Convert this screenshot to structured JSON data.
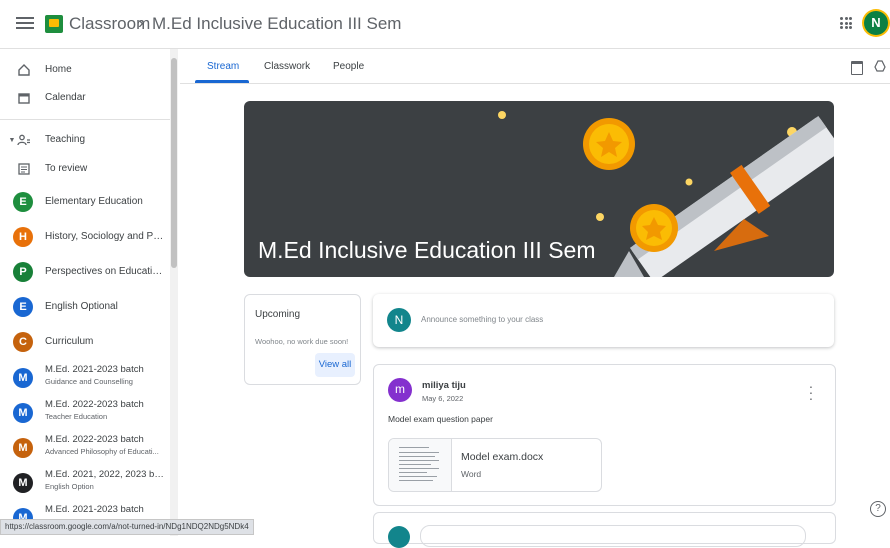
{
  "header": {
    "app_title": "Classroom",
    "separator": "›",
    "course_title": "M.Ed Inclusive Education III Sem",
    "avatar_initial": "N"
  },
  "sidebar": {
    "home": "Home",
    "calendar": "Calendar",
    "teaching": "Teaching",
    "to_review": "To review",
    "classes": [
      {
        "initial": "E",
        "color": "#1e8e3e",
        "name": "Elementary Education"
      },
      {
        "initial": "H",
        "color": "#e8710a",
        "name": "History, Sociology and Poli..."
      },
      {
        "initial": "P",
        "color": "#188038",
        "name": "Perspectives on Education..."
      },
      {
        "initial": "E",
        "color": "#1967d2",
        "name": "English Optional"
      },
      {
        "initial": "C",
        "color": "#c5620d",
        "name": "Curriculum"
      },
      {
        "initial": "M",
        "color": "#1967d2",
        "name": "M.Ed. 2021-2023 batch",
        "section": "Guidance and Counselling"
      },
      {
        "initial": "M",
        "color": "#1967d2",
        "name": "M.Ed. 2022-2023 batch",
        "section": "Teacher Education"
      },
      {
        "initial": "M",
        "color": "#c5620d",
        "name": "M.Ed. 2022-2023 batch",
        "section": "Advanced Philosophy of Educati..."
      },
      {
        "initial": "M",
        "color": "#202124",
        "name": "M.Ed. 2021, 2022, 2023 bat...",
        "section": "English Option"
      },
      {
        "initial": "M",
        "color": "#1967d2",
        "name": "M.Ed. 2021-2023 batch"
      }
    ]
  },
  "status_url": "https://classroom.google.com/a/not-turned-in/NDg1NDQ2NDg5NDk4",
  "tabs": {
    "stream": "Stream",
    "classwork": "Classwork",
    "people": "People"
  },
  "banner": {
    "title": "M.Ed Inclusive Education III Sem"
  },
  "upcoming": {
    "title": "Upcoming",
    "empty_text": "Woohoo, no work due soon!",
    "view_all": "View all"
  },
  "announce": {
    "avatar_initial": "N",
    "placeholder": "Announce something to your class"
  },
  "post": {
    "avatar_initial": "m",
    "author": "miliya tiju",
    "date": "May 6, 2022",
    "message": "Model exam question paper",
    "attachment_name": "Model exam.docx",
    "attachment_type": "Word"
  },
  "icons": {
    "help": "?"
  }
}
